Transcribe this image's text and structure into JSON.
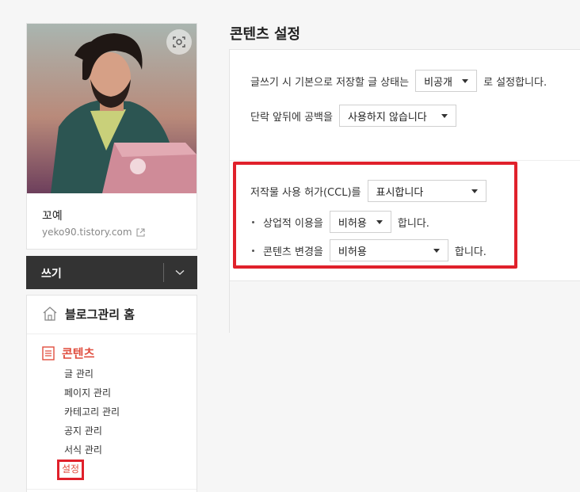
{
  "profile": {
    "name": "꼬예",
    "url": "yeko90.tistory.com"
  },
  "write_bar": {
    "label": "쓰기"
  },
  "menu": {
    "home_label": "블로그관리 홈",
    "contents_label": "콘텐츠",
    "sub_items": [
      "글 관리",
      "페이지 관리",
      "카테고리 관리",
      "공지 관리",
      "서식 관리",
      "설정"
    ],
    "active_sub_item": "설정"
  },
  "main": {
    "title": "콘텐츠 설정",
    "default_status": {
      "prefix": "글쓰기 시 기본으로 저장할 글 상태는",
      "value": "비공개",
      "suffix": "로 설정합니다."
    },
    "paragraph_spacing": {
      "prefix": "단락 앞뒤에 공백을",
      "value": "사용하지 않습니다"
    },
    "ccl": {
      "prefix": "저작물 사용 허가(CCL)를",
      "value": "표시합니다",
      "commercial": {
        "prefix": "상업적 이용을",
        "value": "비허용",
        "suffix": "합니다."
      },
      "modification": {
        "prefix": "콘텐츠 변경을",
        "value": "비허용",
        "suffix": "합니다."
      }
    }
  },
  "colors": {
    "accent_red": "#e04e3f",
    "highlight_red": "#e0212b",
    "write_bar_bg": "#333333"
  }
}
